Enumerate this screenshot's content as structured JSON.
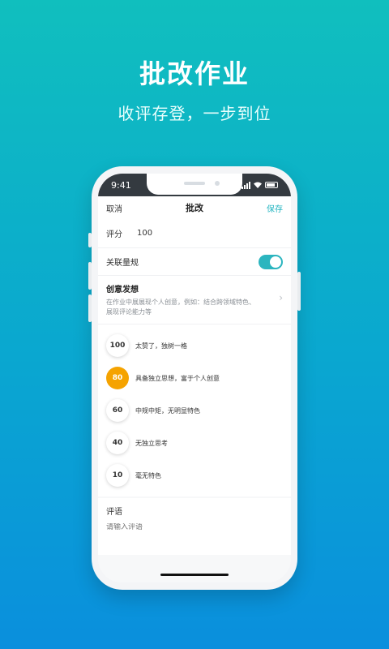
{
  "promo": {
    "headline": "批改作业",
    "subline": "收评存登，一步到位"
  },
  "status_bar": {
    "time": "9:41"
  },
  "navbar": {
    "cancel_label": "取消",
    "title": "批改",
    "save_label": "保存"
  },
  "form": {
    "score_label": "评分",
    "score_value": "100",
    "rubric_toggle_label": "关联量规",
    "rubric_toggle_on": true
  },
  "rubric": {
    "title": "创意发想",
    "description": "在作业中展展现个人创意，例如：结合跨领域特色、展现评论能力等",
    "levels": [
      {
        "score": "100",
        "text": "太赞了，独树一格",
        "selected": false
      },
      {
        "score": "80",
        "text": "具备独立思想，富于个人创意",
        "selected": true
      },
      {
        "score": "60",
        "text": "中规中矩，无明显特色",
        "selected": false
      },
      {
        "score": "40",
        "text": "无独立思考",
        "selected": false
      },
      {
        "score": "10",
        "text": "毫无特色",
        "selected": false
      }
    ]
  },
  "comment": {
    "label": "评语",
    "placeholder": "请输入评语"
  },
  "colors": {
    "accent": "#2bb5bf",
    "selected_level": "#f5a300"
  }
}
